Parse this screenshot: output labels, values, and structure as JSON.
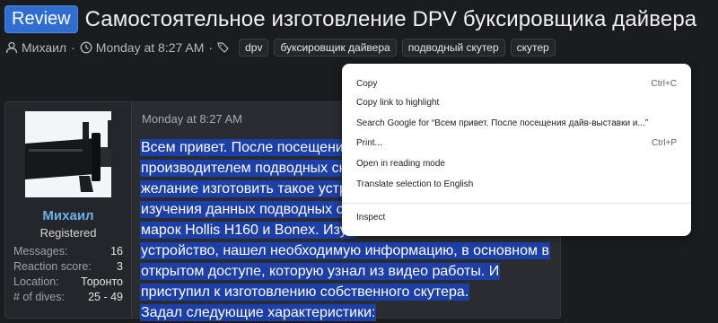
{
  "thread": {
    "badge": "Review",
    "title": "Самостоятельное изготовление DPV буксировщика дайвера",
    "author": "Михаил",
    "date": "Monday at 8:27 AM",
    "tags": [
      "dpv",
      "буксировщик дайвера",
      "подводный скутер",
      "скутер"
    ]
  },
  "post": {
    "date": "Monday at 8:27 AM",
    "user": {
      "name": "Михаил",
      "title": "Registered",
      "stats": [
        {
          "label": "Messages:",
          "value": "16"
        },
        {
          "label": "Reaction score:",
          "value": "3"
        },
        {
          "label": "Location:",
          "value": "Торонто"
        },
        {
          "label": "# of dives:",
          "value": "25 - 49"
        }
      ]
    },
    "lines": [
      "Всем привет. После посещения",
      "производителем подводных ску",
      "желание изготовить такое устро",
      "изучения данных подводных ску",
      "марок Hollis H160 и Bonex. Изуч",
      "устройство, нашел необходимую информацию, в основном в",
      "открытом доступе, которую узнал из видео работы. И",
      "приступил к изготовлению собственного скутера.",
      "Задал следующие характеристики:"
    ]
  },
  "context_menu": {
    "items": [
      {
        "label": "Copy",
        "shortcut": "Ctrl+C"
      },
      {
        "label": "Copy link to highlight",
        "shortcut": ""
      },
      {
        "label": "Search Google for “Всем привет. После посещения дайв-выставки и...”",
        "shortcut": ""
      },
      {
        "label": "Print...",
        "shortcut": "Ctrl+P"
      },
      {
        "label": "Open in reading mode",
        "shortcut": ""
      },
      {
        "label": "Translate selection to English",
        "shortcut": ""
      },
      {
        "label": "Inspect",
        "shortcut": ""
      }
    ]
  },
  "colors": {
    "background": "#1a1c20",
    "badge": "#2f6dd0",
    "selection": "#1d3fa8",
    "username": "#6cb0e8"
  },
  "icons": [
    "user-icon",
    "clock-icon",
    "tags-icon"
  ]
}
